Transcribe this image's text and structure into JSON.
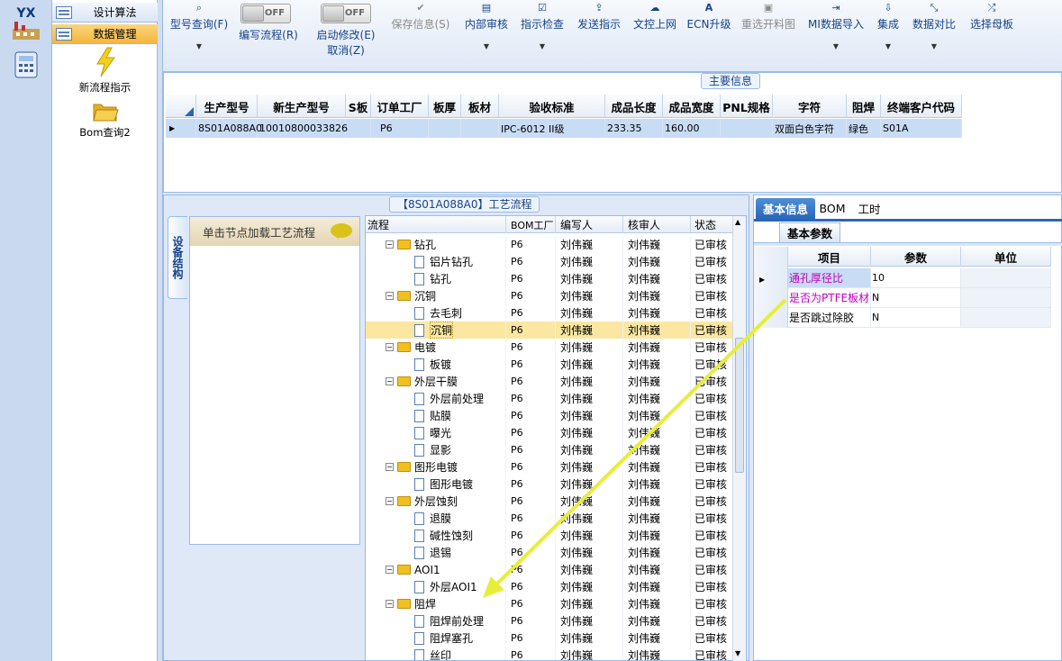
{
  "logo": {
    "text": "YX"
  },
  "nav": {
    "items": [
      {
        "label": "设计算法"
      },
      {
        "label": "数据管理"
      }
    ],
    "tools": [
      {
        "label": "新流程指示",
        "icon": "lightning-icon"
      },
      {
        "label": "Bom查询2",
        "icon": "folder-open-icon"
      }
    ]
  },
  "toolbar": {
    "query": "型号查询(F)",
    "edit_flow": "编写流程(R)",
    "edit_flow_toggle": "OFF",
    "start_modify": "启动修改(E)",
    "start_modify_toggle": "OFF",
    "cancel": "取消(Z)",
    "save": "保存信息(S)",
    "internal_review": "内部审核",
    "instruct_check": "指示检查",
    "send_instruct": "发送指示",
    "doc_upload": "文控上网",
    "ecn_upgrade": "ECN升级",
    "reselect_cut": "重选开料图",
    "mi_import": "MI数据导入",
    "integrate": "集成",
    "data_compare": "数据对比",
    "select_mother": "选择母板"
  },
  "main_info": {
    "title": "主要信息",
    "columns": [
      "生产型号",
      "新生产型号",
      "S板",
      "订单工厂",
      "板厚",
      "板材",
      "验收标准",
      "成品长度",
      "成品宽度",
      "PNL规格",
      "字符",
      "阻焊",
      "终端客户代码"
    ],
    "row": [
      "8S01A088A0",
      "10010800033826",
      "",
      "P6",
      "",
      "",
      "IPC-6012 II级",
      "233.35",
      "160.00",
      "",
      "双面白色字符",
      "绿色",
      "S01A"
    ]
  },
  "process": {
    "title": "【8S01A088A0】工艺流程",
    "side_tab": "设备结构",
    "left_header": "单击节点加载工艺流程",
    "columns": [
      "流程",
      "BOM工厂",
      "编写人",
      "核审人",
      "状态"
    ],
    "rows": [
      {
        "name": "钻孔",
        "type": "folder",
        "factory": "P6",
        "writer": "刘伟巍",
        "reviewer": "刘伟巍",
        "status": "已审核"
      },
      {
        "name": "铝片钻孔",
        "type": "doc",
        "factory": "P6",
        "writer": "刘伟巍",
        "reviewer": "刘伟巍",
        "status": "已审核"
      },
      {
        "name": "钻孔",
        "type": "doc",
        "factory": "P6",
        "writer": "刘伟巍",
        "reviewer": "刘伟巍",
        "status": "已审核"
      },
      {
        "name": "沉铜",
        "type": "folder",
        "factory": "P6",
        "writer": "刘伟巍",
        "reviewer": "刘伟巍",
        "status": "已审核"
      },
      {
        "name": "去毛刺",
        "type": "doc",
        "factory": "P6",
        "writer": "刘伟巍",
        "reviewer": "刘伟巍",
        "status": "已审核"
      },
      {
        "name": "沉铜",
        "type": "doc",
        "factory": "P6",
        "writer": "刘伟巍",
        "reviewer": "刘伟巍",
        "status": "已审核",
        "selected": true
      },
      {
        "name": "电镀",
        "type": "folder",
        "factory": "P6",
        "writer": "刘伟巍",
        "reviewer": "刘伟巍",
        "status": "已审核"
      },
      {
        "name": "板镀",
        "type": "doc",
        "factory": "P6",
        "writer": "刘伟巍",
        "reviewer": "刘伟巍",
        "status": "已审核"
      },
      {
        "name": "外层干膜",
        "type": "folder",
        "factory": "P6",
        "writer": "刘伟巍",
        "reviewer": "刘伟巍",
        "status": "已审核"
      },
      {
        "name": "外层前处理",
        "type": "doc",
        "factory": "P6",
        "writer": "刘伟巍",
        "reviewer": "刘伟巍",
        "status": "已审核"
      },
      {
        "name": "贴膜",
        "type": "doc",
        "factory": "P6",
        "writer": "刘伟巍",
        "reviewer": "刘伟巍",
        "status": "已审核"
      },
      {
        "name": "曝光",
        "type": "doc",
        "factory": "P6",
        "writer": "刘伟巍",
        "reviewer": "刘伟巍",
        "status": "已审核"
      },
      {
        "name": "显影",
        "type": "doc",
        "factory": "P6",
        "writer": "刘伟巍",
        "reviewer": "刘伟巍",
        "status": "已审核"
      },
      {
        "name": "图形电镀",
        "type": "folder",
        "factory": "P6",
        "writer": "刘伟巍",
        "reviewer": "刘伟巍",
        "status": "已审核"
      },
      {
        "name": "图形电镀",
        "type": "doc",
        "factory": "P6",
        "writer": "刘伟巍",
        "reviewer": "刘伟巍",
        "status": "已审核"
      },
      {
        "name": "外层蚀刻",
        "type": "folder",
        "factory": "P6",
        "writer": "刘伟巍",
        "reviewer": "刘伟巍",
        "status": "已审核"
      },
      {
        "name": "退膜",
        "type": "doc",
        "factory": "P6",
        "writer": "刘伟巍",
        "reviewer": "刘伟巍",
        "status": "已审核"
      },
      {
        "name": "碱性蚀刻",
        "type": "doc",
        "factory": "P6",
        "writer": "刘伟巍",
        "reviewer": "刘伟巍",
        "status": "已审核"
      },
      {
        "name": "退锡",
        "type": "doc",
        "factory": "P6",
        "writer": "刘伟巍",
        "reviewer": "刘伟巍",
        "status": "已审核"
      },
      {
        "name": "AOI1",
        "type": "folder",
        "factory": "P6",
        "writer": "刘伟巍",
        "reviewer": "刘伟巍",
        "status": "已审核"
      },
      {
        "name": "外层AOI1",
        "type": "doc",
        "factory": "P6",
        "writer": "刘伟巍",
        "reviewer": "刘伟巍",
        "status": "已审核"
      },
      {
        "name": "阻焊",
        "type": "folder",
        "factory": "P6",
        "writer": "刘伟巍",
        "reviewer": "刘伟巍",
        "status": "已审核"
      },
      {
        "name": "阻焊前处理",
        "type": "doc",
        "factory": "P6",
        "writer": "刘伟巍",
        "reviewer": "刘伟巍",
        "status": "已审核"
      },
      {
        "name": "阻焊塞孔",
        "type": "doc",
        "factory": "P6",
        "writer": "刘伟巍",
        "reviewer": "刘伟巍",
        "status": "已审核"
      },
      {
        "name": "丝印",
        "type": "doc",
        "factory": "P6",
        "writer": "刘伟巍",
        "reviewer": "刘伟巍",
        "status": "已审核"
      }
    ]
  },
  "right": {
    "tabs": [
      "基本信息",
      "BOM",
      "工时"
    ],
    "subtab": "基本参数",
    "columns": [
      "项目",
      "参数",
      "单位"
    ],
    "rows": [
      {
        "item": "通孔厚径比",
        "value": "10",
        "unit": ""
      },
      {
        "item": "是否为PTFE板材",
        "value": "N",
        "unit": ""
      },
      {
        "item": "是否跳过除胶",
        "value": "N",
        "unit": ""
      }
    ]
  },
  "colors": {
    "accent": "#15428b",
    "highlight_text": "#c000c0",
    "selected_row": "#fbe7a2",
    "annotation_arrow": "#e6ee3a"
  }
}
